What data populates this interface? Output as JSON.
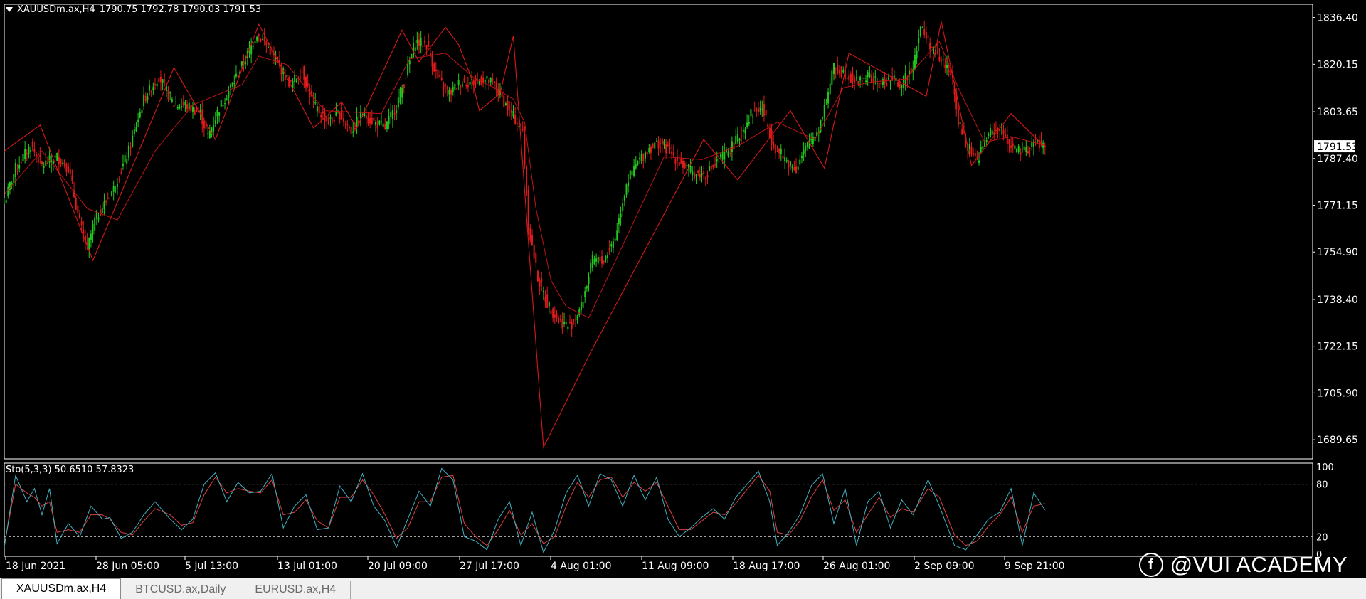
{
  "chart_header": {
    "symbol_timeframe": "XAUUSDm.ax,H4",
    "ohlc": "1790.75 1792.78 1790.03 1791.53"
  },
  "indicator_header": "Sto(5,3,3) 50.6510 57.8323",
  "watermark": "@VUI ACADEMY",
  "watermark_logo_icon": "vui-logo-icon",
  "tabs": [
    {
      "label": "XAUUSDm.ax,H4",
      "active": true
    },
    {
      "label": "BTCUSD.ax,Daily",
      "active": false
    },
    {
      "label": "EURUSD.ax,H4",
      "active": false
    }
  ],
  "colors": {
    "background": "#000000",
    "bull": "#22c81e",
    "bear": "#e01b1b",
    "zigzag": "#d81818",
    "sto_main": "#3fb0c0",
    "sto_signal": "#e04040",
    "axis": "#ffffff",
    "current_price_box": "#ffffff"
  },
  "chart_data": [
    {
      "type": "candlestick",
      "title": "XAUUSDm.ax,H4",
      "current_price": 1791.53,
      "y_ticks": [
        1836.4,
        1820.15,
        1803.65,
        1787.4,
        1771.15,
        1754.9,
        1738.4,
        1722.15,
        1705.9,
        1689.65
      ],
      "y_tick_labels": [
        "1836.40",
        "1820.15",
        "1803.65",
        "1787.40",
        "1771.15",
        "1754.90",
        "1738.40",
        "1722.15",
        "1705.90",
        "1689.65"
      ],
      "ylim": [
        1683.0,
        1841.0
      ],
      "x_tick_labels": [
        "18 Jun 2021",
        "28 Jun 05:00",
        "5 Jul 13:00",
        "13 Jul 01:00",
        "20 Jul 09:00",
        "27 Jul 17:00",
        "4 Aug 01:00",
        "11 Aug 09:00",
        "18 Aug 17:00",
        "26 Aug 01:00",
        "2 Sep 09:00",
        "9 Sep 21:00"
      ],
      "close_anchors": [
        [
          0,
          1772
        ],
        [
          6,
          1784
        ],
        [
          14,
          1792
        ],
        [
          20,
          1785
        ],
        [
          28,
          1788
        ],
        [
          34,
          1784
        ],
        [
          40,
          1765
        ],
        [
          44,
          1756
        ],
        [
          48,
          1766
        ],
        [
          58,
          1777
        ],
        [
          66,
          1790
        ],
        [
          74,
          1808
        ],
        [
          82,
          1816
        ],
        [
          90,
          1806
        ],
        [
          96,
          1806
        ],
        [
          104,
          1803
        ],
        [
          108,
          1795
        ],
        [
          114,
          1805
        ],
        [
          120,
          1812
        ],
        [
          128,
          1822
        ],
        [
          134,
          1831
        ],
        [
          140,
          1826
        ],
        [
          146,
          1819
        ],
        [
          152,
          1813
        ],
        [
          158,
          1818
        ],
        [
          164,
          1806
        ],
        [
          172,
          1800
        ],
        [
          178,
          1803
        ],
        [
          184,
          1797
        ],
        [
          190,
          1803
        ],
        [
          196,
          1800
        ],
        [
          202,
          1798
        ],
        [
          208,
          1806
        ],
        [
          212,
          1814
        ],
        [
          218,
          1828
        ],
        [
          224,
          1827
        ],
        [
          230,
          1815
        ],
        [
          236,
          1810
        ],
        [
          242,
          1814
        ],
        [
          248,
          1814
        ],
        [
          254,
          1815
        ],
        [
          260,
          1813
        ],
        [
          266,
          1806
        ],
        [
          272,
          1800
        ],
        [
          275,
          1797
        ],
        [
          278,
          1764
        ],
        [
          283,
          1746
        ],
        [
          288,
          1737
        ],
        [
          294,
          1731
        ],
        [
          300,
          1729
        ],
        [
          306,
          1736
        ],
        [
          312,
          1752
        ],
        [
          318,
          1752
        ],
        [
          324,
          1760
        ],
        [
          330,
          1779
        ],
        [
          336,
          1786
        ],
        [
          342,
          1791
        ],
        [
          348,
          1793
        ],
        [
          354,
          1789
        ],
        [
          360,
          1785
        ],
        [
          366,
          1782
        ],
        [
          372,
          1782
        ],
        [
          378,
          1786
        ],
        [
          384,
          1790
        ],
        [
          390,
          1795
        ],
        [
          396,
          1803
        ],
        [
          402,
          1805
        ],
        [
          408,
          1792
        ],
        [
          414,
          1787
        ],
        [
          420,
          1784
        ],
        [
          426,
          1792
        ],
        [
          432,
          1798
        ],
        [
          436,
          1808
        ],
        [
          440,
          1819
        ],
        [
          446,
          1817
        ],
        [
          452,
          1814
        ],
        [
          458,
          1816
        ],
        [
          464,
          1813
        ],
        [
          470,
          1815
        ],
        [
          476,
          1813
        ],
        [
          482,
          1820
        ],
        [
          486,
          1833
        ],
        [
          492,
          1826
        ],
        [
          496,
          1822
        ],
        [
          502,
          1818
        ],
        [
          506,
          1800
        ],
        [
          510,
          1793
        ],
        [
          516,
          1787
        ],
        [
          522,
          1796
        ],
        [
          528,
          1798
        ],
        [
          534,
          1792
        ],
        [
          540,
          1789
        ],
        [
          546,
          1793
        ],
        [
          552,
          1791.53
        ]
      ],
      "zigzag": [
        [
          0,
          1790
        ],
        [
          19,
          1799
        ],
        [
          47,
          1752
        ],
        [
          90,
          1819
        ],
        [
          112,
          1794
        ],
        [
          135,
          1834
        ],
        [
          164,
          1798
        ],
        [
          179,
          1807
        ],
        [
          187,
          1798
        ],
        [
          211,
          1832
        ],
        [
          220,
          1821
        ],
        [
          234,
          1833
        ],
        [
          241,
          1827
        ],
        [
          248,
          1815
        ],
        [
          252,
          1804
        ],
        [
          263,
          1810
        ],
        [
          270,
          1830
        ],
        [
          286,
          1687
        ],
        [
          311,
          1720
        ],
        [
          371,
          1794
        ],
        [
          389,
          1780
        ],
        [
          417,
          1804
        ],
        [
          435,
          1784
        ],
        [
          448,
          1824
        ],
        [
          489,
          1809
        ],
        [
          497,
          1835
        ],
        [
          513,
          1785
        ],
        [
          534,
          1803
        ],
        [
          551,
          1792
        ]
      ],
      "ma": [
        [
          0,
          1775
        ],
        [
          20,
          1790
        ],
        [
          44,
          1770
        ],
        [
          60,
          1766
        ],
        [
          80,
          1790
        ],
        [
          100,
          1806
        ],
        [
          126,
          1813
        ],
        [
          135,
          1823
        ],
        [
          150,
          1820
        ],
        [
          170,
          1804
        ],
        [
          200,
          1803
        ],
        [
          215,
          1822
        ],
        [
          234,
          1824
        ],
        [
          250,
          1815
        ],
        [
          260,
          1812
        ],
        [
          270,
          1808
        ],
        [
          276,
          1800
        ],
        [
          282,
          1770
        ],
        [
          290,
          1745
        ],
        [
          298,
          1736
        ],
        [
          310,
          1732
        ],
        [
          330,
          1760
        ],
        [
          350,
          1788
        ],
        [
          370,
          1787
        ],
        [
          390,
          1792
        ],
        [
          410,
          1800
        ],
        [
          430,
          1794
        ],
        [
          445,
          1812
        ],
        [
          460,
          1814
        ],
        [
          478,
          1815
        ],
        [
          496,
          1828
        ],
        [
          506,
          1812
        ],
        [
          520,
          1793
        ],
        [
          534,
          1795
        ],
        [
          552,
          1792
        ]
      ]
    },
    {
      "type": "line",
      "title": "Sto(5,3,3)",
      "series": [
        {
          "name": "main",
          "values": [
            50.651
          ]
        },
        {
          "name": "signal",
          "values": [
            57.8323
          ]
        }
      ],
      "levels": [
        20,
        80
      ],
      "y_tick_labels": [
        "100",
        "80",
        "20",
        "0"
      ],
      "ylim": [
        0,
        100
      ],
      "main_anchors": [
        [
          0,
          8
        ],
        [
          6,
          90
        ],
        [
          12,
          60
        ],
        [
          16,
          75
        ],
        [
          20,
          45
        ],
        [
          24,
          75
        ],
        [
          28,
          12
        ],
        [
          34,
          35
        ],
        [
          40,
          20
        ],
        [
          46,
          55
        ],
        [
          52,
          40
        ],
        [
          56,
          42
        ],
        [
          62,
          18
        ],
        [
          68,
          25
        ],
        [
          74,
          45
        ],
        [
          80,
          60
        ],
        [
          88,
          40
        ],
        [
          94,
          28
        ],
        [
          100,
          40
        ],
        [
          106,
          80
        ],
        [
          112,
          93
        ],
        [
          118,
          60
        ],
        [
          124,
          82
        ],
        [
          130,
          70
        ],
        [
          136,
          72
        ],
        [
          142,
          92
        ],
        [
          148,
          30
        ],
        [
          154,
          55
        ],
        [
          160,
          68
        ],
        [
          166,
          28
        ],
        [
          172,
          30
        ],
        [
          178,
          78
        ],
        [
          184,
          60
        ],
        [
          190,
          92
        ],
        [
          196,
          55
        ],
        [
          202,
          38
        ],
        [
          208,
          8
        ],
        [
          214,
          40
        ],
        [
          220,
          72
        ],
        [
          226,
          55
        ],
        [
          232,
          98
        ],
        [
          238,
          85
        ],
        [
          244,
          20
        ],
        [
          250,
          15
        ],
        [
          256,
          5
        ],
        [
          262,
          40
        ],
        [
          268,
          60
        ],
        [
          274,
          10
        ],
        [
          280,
          48
        ],
        [
          286,
          2
        ],
        [
          292,
          28
        ],
        [
          298,
          70
        ],
        [
          304,
          90
        ],
        [
          310,
          55
        ],
        [
          316,
          92
        ],
        [
          322,
          85
        ],
        [
          328,
          55
        ],
        [
          334,
          90
        ],
        [
          340,
          62
        ],
        [
          346,
          88
        ],
        [
          352,
          40
        ],
        [
          358,
          20
        ],
        [
          364,
          30
        ],
        [
          370,
          42
        ],
        [
          376,
          52
        ],
        [
          382,
          40
        ],
        [
          388,
          65
        ],
        [
          394,
          80
        ],
        [
          400,
          95
        ],
        [
          406,
          60
        ],
        [
          410,
          10
        ],
        [
          416,
          25
        ],
        [
          422,
          45
        ],
        [
          428,
          78
        ],
        [
          434,
          92
        ],
        [
          440,
          35
        ],
        [
          446,
          75
        ],
        [
          452,
          10
        ],
        [
          458,
          60
        ],
        [
          464,
          72
        ],
        [
          470,
          30
        ],
        [
          476,
          62
        ],
        [
          482,
          45
        ],
        [
          490,
          85
        ],
        [
          496,
          55
        ],
        [
          504,
          10
        ],
        [
          510,
          5
        ],
        [
          516,
          22
        ],
        [
          522,
          40
        ],
        [
          528,
          48
        ],
        [
          534,
          75
        ],
        [
          540,
          10
        ],
        [
          546,
          70
        ],
        [
          552,
          50.65
        ]
      ],
      "signal_anchors": [
        [
          0,
          10
        ],
        [
          6,
          80
        ],
        [
          12,
          70
        ],
        [
          16,
          65
        ],
        [
          20,
          55
        ],
        [
          24,
          60
        ],
        [
          28,
          25
        ],
        [
          34,
          28
        ],
        [
          40,
          25
        ],
        [
          46,
          45
        ],
        [
          52,
          45
        ],
        [
          56,
          40
        ],
        [
          62,
          25
        ],
        [
          68,
          22
        ],
        [
          74,
          38
        ],
        [
          80,
          52
        ],
        [
          88,
          45
        ],
        [
          94,
          33
        ],
        [
          100,
          36
        ],
        [
          106,
          68
        ],
        [
          112,
          88
        ],
        [
          118,
          70
        ],
        [
          124,
          75
        ],
        [
          130,
          72
        ],
        [
          136,
          70
        ],
        [
          142,
          85
        ],
        [
          148,
          45
        ],
        [
          154,
          48
        ],
        [
          160,
          62
        ],
        [
          166,
          38
        ],
        [
          172,
          30
        ],
        [
          178,
          65
        ],
        [
          184,
          65
        ],
        [
          190,
          85
        ],
        [
          196,
          68
        ],
        [
          202,
          45
        ],
        [
          208,
          18
        ],
        [
          214,
          30
        ],
        [
          220,
          60
        ],
        [
          226,
          60
        ],
        [
          232,
          88
        ],
        [
          238,
          90
        ],
        [
          244,
          35
        ],
        [
          250,
          20
        ],
        [
          256,
          10
        ],
        [
          262,
          28
        ],
        [
          268,
          50
        ],
        [
          274,
          22
        ],
        [
          280,
          35
        ],
        [
          286,
          12
        ],
        [
          292,
          20
        ],
        [
          298,
          55
        ],
        [
          304,
          82
        ],
        [
          310,
          65
        ],
        [
          316,
          85
        ],
        [
          322,
          88
        ],
        [
          328,
          65
        ],
        [
          334,
          82
        ],
        [
          340,
          72
        ],
        [
          346,
          82
        ],
        [
          352,
          55
        ],
        [
          358,
          28
        ],
        [
          364,
          28
        ],
        [
          370,
          38
        ],
        [
          376,
          48
        ],
        [
          382,
          45
        ],
        [
          388,
          58
        ],
        [
          394,
          74
        ],
        [
          400,
          90
        ],
        [
          406,
          72
        ],
        [
          410,
          25
        ],
        [
          416,
          22
        ],
        [
          422,
          38
        ],
        [
          428,
          65
        ],
        [
          434,
          85
        ],
        [
          440,
          50
        ],
        [
          446,
          62
        ],
        [
          452,
          25
        ],
        [
          458,
          45
        ],
        [
          464,
          65
        ],
        [
          470,
          42
        ],
        [
          476,
          52
        ],
        [
          482,
          48
        ],
        [
          490,
          75
        ],
        [
          496,
          65
        ],
        [
          504,
          22
        ],
        [
          510,
          10
        ],
        [
          516,
          15
        ],
        [
          522,
          32
        ],
        [
          528,
          45
        ],
        [
          534,
          65
        ],
        [
          540,
          25
        ],
        [
          546,
          55
        ],
        [
          552,
          57.83
        ]
      ]
    }
  ]
}
